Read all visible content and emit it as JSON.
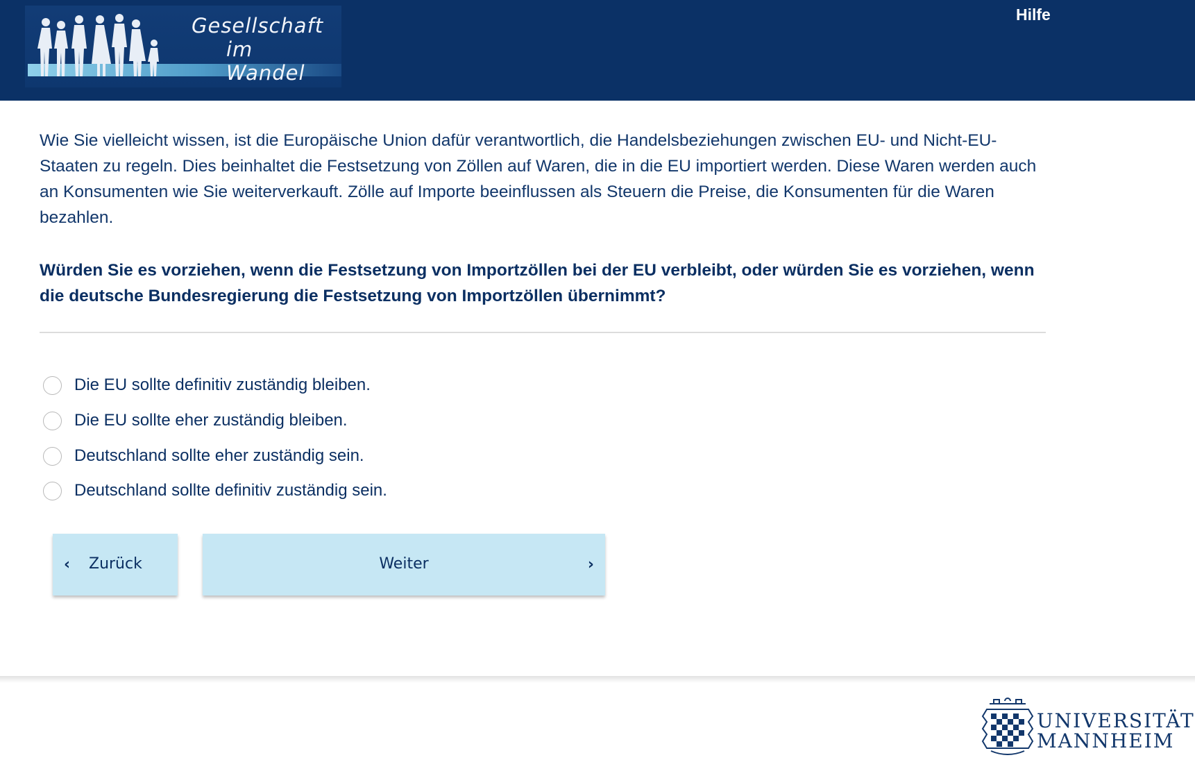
{
  "header": {
    "logo": {
      "line1": "Gesellschaft",
      "line2": "im Wandel"
    },
    "help_label": "Hilfe"
  },
  "main": {
    "intro": "Wie Sie vielleicht wissen, ist die Europäische Union dafür verantwortlich, die Handelsbeziehungen zwischen EU- und Nicht-EU-Staaten zu regeln. Dies beinhaltet die Festsetzung von Zöllen auf Waren, die in die EU importiert werden. Diese Waren werden auch an Konsumenten wie Sie weiterverkauft. Zölle auf Importe beeinflussen als Steuern die Preise, die Konsumenten für die Waren bezahlen.",
    "question": "Würden Sie es vorziehen, wenn die Festsetzung von Importzöllen bei der EU verbleibt, oder würden Sie es vorziehen, wenn die deutsche Bundesregierung die Festsetzung von Importzöllen übernimmt?",
    "options": [
      {
        "label": "Die EU sollte definitiv zuständig bleiben.",
        "selected": false
      },
      {
        "label": "Die EU sollte eher zuständig bleiben.",
        "selected": false
      },
      {
        "label": "Deutschland sollte eher zuständig sein.",
        "selected": false
      },
      {
        "label": "Deutschland sollte definitiv zuständig sein.",
        "selected": false
      }
    ]
  },
  "navigation": {
    "back_label": "Zurück",
    "back_icon": "chevron-left-icon",
    "next_label": "Weiter",
    "next_icon": "chevron-right-icon"
  },
  "footer": {
    "university_line1": "UNIVERSITÄT",
    "university_line2": "MANNHEIM"
  },
  "colors": {
    "header_bg": "#0b3166",
    "text": "#0b2f62",
    "button_bg": "#c6e7f4"
  }
}
